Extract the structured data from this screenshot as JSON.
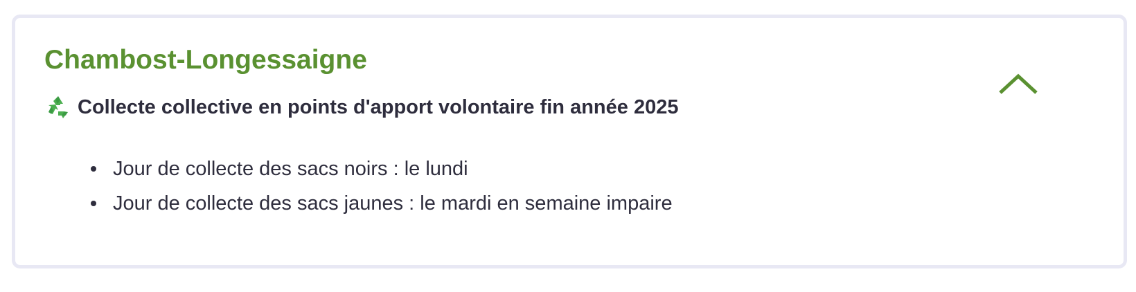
{
  "card": {
    "title": "Chambost-Longessaigne",
    "expanded": true,
    "toggle_icon": "chevron-up-icon",
    "section": {
      "icon": "recycling-icon",
      "heading": "Collecte collective en points d'apport volontaire fin année 2025",
      "items": [
        "Jour de collecte des sacs noirs : le lundi",
        "Jour de collecte des sacs jaunes : le mardi en semaine impaire"
      ]
    }
  },
  "colors": {
    "title": "#5a9131",
    "text": "#2e2d3d",
    "border": "#e8e8f4",
    "recycling_icon": "#4caf50"
  }
}
